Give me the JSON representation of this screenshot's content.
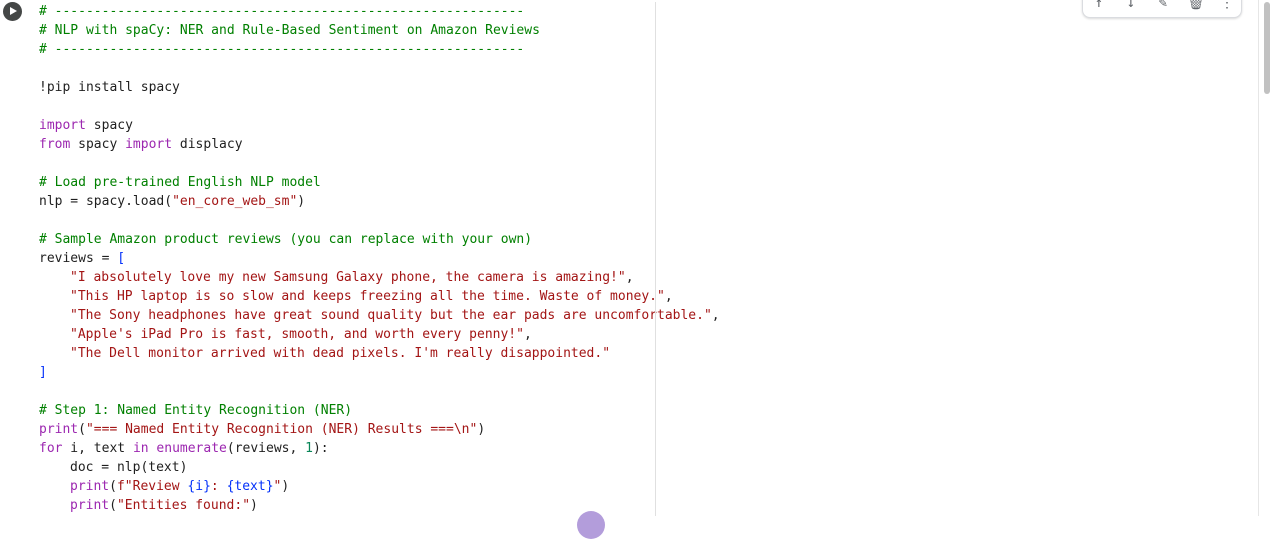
{
  "cell": {
    "run_button_label": "Run cell",
    "lines": [
      {
        "indent": 0,
        "tokens": [
          {
            "t": "# ------------------------------------------------------------",
            "c": "c-com"
          }
        ]
      },
      {
        "indent": 0,
        "tokens": [
          {
            "t": "# NLP with spaCy: NER and Rule-Based Sentiment on Amazon Reviews",
            "c": "c-com"
          }
        ]
      },
      {
        "indent": 0,
        "tokens": [
          {
            "t": "# ------------------------------------------------------------",
            "c": "c-com"
          }
        ]
      },
      {
        "indent": 0,
        "tokens": []
      },
      {
        "indent": 0,
        "tokens": [
          {
            "t": "!pip install spacy",
            "c": ""
          }
        ]
      },
      {
        "indent": 0,
        "tokens": []
      },
      {
        "indent": 0,
        "tokens": [
          {
            "t": "import",
            "c": "c-kw"
          },
          {
            "t": " spacy",
            "c": ""
          }
        ]
      },
      {
        "indent": 0,
        "tokens": [
          {
            "t": "from",
            "c": "c-kw"
          },
          {
            "t": " spacy ",
            "c": ""
          },
          {
            "t": "import",
            "c": "c-kw"
          },
          {
            "t": " displacy",
            "c": ""
          }
        ]
      },
      {
        "indent": 0,
        "tokens": []
      },
      {
        "indent": 0,
        "tokens": [
          {
            "t": "# Load pre-trained English NLP model",
            "c": "c-com"
          }
        ]
      },
      {
        "indent": 0,
        "tokens": [
          {
            "t": "nlp = spacy.load(",
            "c": ""
          },
          {
            "t": "\"en_core_web_sm\"",
            "c": "c-str"
          },
          {
            "t": ")",
            "c": ""
          }
        ]
      },
      {
        "indent": 0,
        "tokens": []
      },
      {
        "indent": 0,
        "tokens": [
          {
            "t": "# Sample Amazon product reviews (you can replace with your own)",
            "c": "c-com"
          }
        ]
      },
      {
        "indent": 0,
        "tokens": [
          {
            "t": "reviews = ",
            "c": ""
          },
          {
            "t": "[",
            "c": "c-br"
          }
        ]
      },
      {
        "indent": 1,
        "tokens": [
          {
            "t": "\"I absolutely love my new Samsung Galaxy phone, the camera is amazing!\"",
            "c": "c-str"
          },
          {
            "t": ",",
            "c": ""
          }
        ]
      },
      {
        "indent": 1,
        "tokens": [
          {
            "t": "\"This HP laptop is so slow and keeps freezing all the time. Waste of money.\"",
            "c": "c-str"
          },
          {
            "t": ",",
            "c": ""
          }
        ]
      },
      {
        "indent": 1,
        "tokens": [
          {
            "t": "\"The Sony headphones have great sound quality but the ear pads are uncomfortable.\"",
            "c": "c-str"
          },
          {
            "t": ",",
            "c": ""
          }
        ]
      },
      {
        "indent": 1,
        "tokens": [
          {
            "t": "\"Apple's iPad Pro is fast, smooth, and worth every penny!\"",
            "c": "c-str"
          },
          {
            "t": ",",
            "c": ""
          }
        ]
      },
      {
        "indent": 1,
        "tokens": [
          {
            "t": "\"The Dell monitor arrived with dead pixels. I'm really disappointed.\"",
            "c": "c-str"
          }
        ]
      },
      {
        "indent": 0,
        "tokens": [
          {
            "t": "]",
            "c": "c-br"
          }
        ]
      },
      {
        "indent": 0,
        "tokens": []
      },
      {
        "indent": 0,
        "tokens": [
          {
            "t": "# Step 1: Named Entity Recognition (NER)",
            "c": "c-com"
          }
        ]
      },
      {
        "indent": 0,
        "tokens": [
          {
            "t": "print",
            "c": "c-bi"
          },
          {
            "t": "(",
            "c": ""
          },
          {
            "t": "\"=== Named Entity Recognition (NER) Results ===\\n\"",
            "c": "c-str"
          },
          {
            "t": ")",
            "c": ""
          }
        ]
      },
      {
        "indent": 0,
        "tokens": [
          {
            "t": "for",
            "c": "c-kw"
          },
          {
            "t": " i, text ",
            "c": ""
          },
          {
            "t": "in",
            "c": "c-kw"
          },
          {
            "t": " ",
            "c": ""
          },
          {
            "t": "enumerate",
            "c": "c-bi"
          },
          {
            "t": "(reviews, ",
            "c": ""
          },
          {
            "t": "1",
            "c": "c-num"
          },
          {
            "t": "):",
            "c": ""
          }
        ]
      },
      {
        "indent": 1,
        "tokens": [
          {
            "t": "doc = nlp(text)",
            "c": ""
          }
        ]
      },
      {
        "indent": 1,
        "tokens": [
          {
            "t": "print",
            "c": "c-bi"
          },
          {
            "t": "(",
            "c": ""
          },
          {
            "t": "f\"Review ",
            "c": "c-str"
          },
          {
            "t": "{i}",
            "c": "c-br"
          },
          {
            "t": ": ",
            "c": "c-str"
          },
          {
            "t": "{text}",
            "c": "c-br"
          },
          {
            "t": "\"",
            "c": "c-str"
          },
          {
            "t": ")",
            "c": ""
          }
        ]
      },
      {
        "indent": 1,
        "tokens": [
          {
            "t": "print",
            "c": "c-bi"
          },
          {
            "t": "(",
            "c": ""
          },
          {
            "t": "\"Entities found:\"",
            "c": "c-str"
          },
          {
            "t": ")",
            "c": ""
          }
        ]
      }
    ]
  },
  "toolbar": {
    "icons": [
      "arrow-up-icon",
      "arrow-down-icon",
      "pencil-icon",
      "trash-icon",
      "more-vert-icon"
    ],
    "glyphs": [
      "↑",
      "↓",
      "✎",
      "🗑",
      "⋮"
    ]
  }
}
